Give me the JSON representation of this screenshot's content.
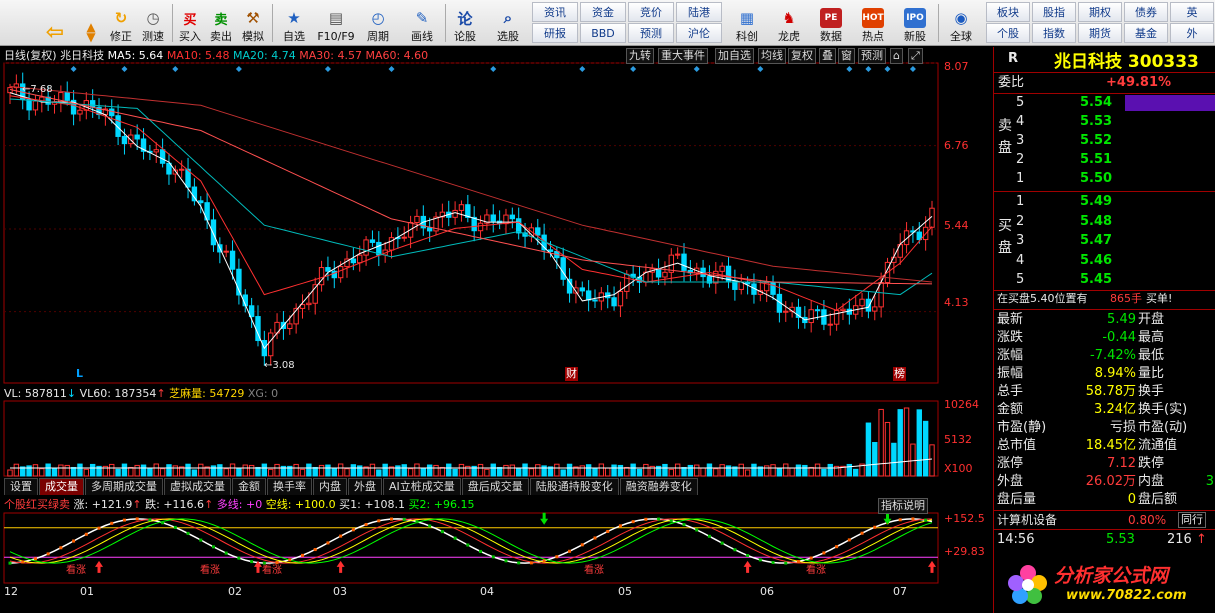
{
  "toolbar": {
    "buttons": [
      {
        "label": "修正"
      },
      {
        "label": "测速"
      },
      {
        "label": "买入",
        "glyph": "买"
      },
      {
        "label": "卖出",
        "glyph": "卖"
      },
      {
        "label": "模拟"
      },
      {
        "label": "自选"
      },
      {
        "label": "F10/F9"
      },
      {
        "label": "周期"
      },
      {
        "label": "画线"
      },
      {
        "label": "论股",
        "glyph": "论"
      },
      {
        "label": "选股"
      },
      {
        "label": "科创"
      },
      {
        "label": "龙虎"
      },
      {
        "label": "数据"
      },
      {
        "label": "热点"
      },
      {
        "label": "新股"
      },
      {
        "label": "全球"
      }
    ],
    "grid_left": [
      "资讯",
      "资金",
      "竞价",
      "陆港",
      "研报",
      "BBD",
      "预测",
      "沪伦"
    ],
    "grid_right": [
      "板块",
      "股指",
      "期权",
      "债券",
      "个股",
      "指数",
      "期货",
      "基金"
    ],
    "grid_right_cut": [
      "英",
      "外"
    ]
  },
  "chart_header": {
    "period": "日线(复权)",
    "stock_name": "兆日科技",
    "ma": [
      {
        "label": "MA5: 5.64",
        "color": "#ffffff"
      },
      {
        "label": "MA10: 5.48",
        "color": "#ff3030"
      },
      {
        "label": "MA20: 4.74",
        "color": "#00cccc"
      },
      {
        "label": "MA30: 4.57",
        "color": "#ff4040"
      },
      {
        "label": "MA60: 4.60",
        "color": "#ff4040"
      }
    ],
    "tags": [
      "九转",
      "重大事件",
      "加自选",
      "均线",
      "复权",
      "叠",
      "窗",
      "预测"
    ]
  },
  "price_axis": [
    "8.07",
    "6.76",
    "5.44",
    "4.13"
  ],
  "markers": {
    "high_label": "7.68",
    "low_label": "3.08",
    "events": [
      "L",
      "财",
      "榜"
    ]
  },
  "volume_header": {
    "vl": "VL: 587811",
    "vl60": "VL60: 187354",
    "zhima": "芝麻量: 54729",
    "xg": "XG: 0"
  },
  "volume_axis": [
    "10264",
    "5132",
    "X100"
  ],
  "tabs": [
    {
      "label": "设置",
      "active": false
    },
    {
      "label": "成交量",
      "active": true
    },
    {
      "label": "多周期成交量",
      "active": false
    },
    {
      "label": "虚拟成交量",
      "active": false
    },
    {
      "label": "金额",
      "active": false
    },
    {
      "label": "换手率",
      "active": false
    },
    {
      "label": "内盘",
      "active": false
    },
    {
      "label": "外盘",
      "active": false
    },
    {
      "label": "AI立桩成交量",
      "active": false
    },
    {
      "label": "盘后成交量",
      "active": false
    },
    {
      "label": "陆股通持股变化",
      "active": false
    },
    {
      "label": "融资融券变化",
      "active": false
    }
  ],
  "indicator_button": "指标说明",
  "indicator_header": {
    "name": "个股红买绿卖",
    "zhang": "涨: +121.9",
    "die": "跌: +116.6",
    "duoxian": "多线: +0",
    "kongxian": "空线: +100.0",
    "mai1": "买1: +108.1",
    "mai2": "买2: +96.15"
  },
  "indicator_axis": [
    "+152.5",
    "+29.83"
  ],
  "indicator_marks": [
    "看涨",
    "看涨",
    "看涨",
    "看涨",
    "看涨"
  ],
  "x_axis": [
    "12",
    "01",
    "02",
    "03",
    "04",
    "05",
    "06",
    "07"
  ],
  "chart_data": {
    "type": "line",
    "title": "",
    "series": [
      {
        "name": "MA5",
        "x": [
          0,
          5,
          10,
          15,
          20,
          25,
          30,
          35,
          40,
          45,
          50,
          55,
          60,
          65,
          70,
          75,
          80,
          85,
          90,
          95,
          100,
          105,
          110,
          115,
          120,
          125,
          130,
          135,
          140,
          145
        ],
        "values": [
          7.6,
          7.45,
          7.45,
          7.25,
          6.75,
          6.5,
          5.8,
          4.7,
          3.55,
          4.15,
          4.75,
          5.05,
          5.25,
          5.55,
          5.7,
          5.55,
          5.55,
          5.05,
          4.3,
          4.4,
          4.75,
          4.9,
          4.7,
          4.6,
          4.35,
          4.0,
          4.1,
          4.2,
          5.2,
          5.64
        ]
      },
      {
        "name": "MA10",
        "x": [
          0,
          10,
          20,
          30,
          40,
          50,
          60,
          70,
          80,
          90,
          100,
          110,
          120,
          130,
          140,
          145
        ],
        "values": [
          7.55,
          7.4,
          7.05,
          6.2,
          4.4,
          4.7,
          5.1,
          5.45,
          5.55,
          4.8,
          4.6,
          4.75,
          4.55,
          4.15,
          4.9,
          5.48
        ]
      },
      {
        "name": "MA20",
        "x": [
          0,
          20,
          40,
          60,
          80,
          100,
          120,
          140,
          145
        ],
        "values": [
          7.5,
          7.35,
          5.5,
          5.0,
          5.4,
          4.6,
          4.6,
          4.4,
          4.74
        ]
      },
      {
        "name": "MA30",
        "x": [
          0,
          30,
          60,
          90,
          120,
          145
        ],
        "values": [
          7.65,
          7.0,
          5.6,
          4.95,
          4.6,
          4.57
        ]
      },
      {
        "name": "MA60",
        "x": [
          0,
          30,
          60,
          90,
          120,
          145
        ],
        "values": [
          7.7,
          7.4,
          6.45,
          5.5,
          4.85,
          4.6
        ]
      }
    ],
    "ylim": [
      3.0,
      8.07
    ],
    "high": 7.68,
    "low": 3.08
  },
  "quote": {
    "code_prefix": "R",
    "title": "兆日科技 300333",
    "weibi_label": "委比",
    "weibi_value": "+49.81%",
    "sell_label": [
      "卖",
      "盘"
    ],
    "buy_label": [
      "买",
      "盘"
    ],
    "sell": [
      {
        "level": "5",
        "price": "5.54"
      },
      {
        "level": "4",
        "price": "5.53"
      },
      {
        "level": "3",
        "price": "5.52"
      },
      {
        "level": "2",
        "price": "5.51"
      },
      {
        "level": "1",
        "price": "5.50"
      }
    ],
    "buy": [
      {
        "level": "1",
        "price": "5.49"
      },
      {
        "level": "2",
        "price": "5.48"
      },
      {
        "level": "3",
        "price": "5.47"
      },
      {
        "level": "4",
        "price": "5.46"
      },
      {
        "level": "5",
        "price": "5.45"
      }
    ],
    "sell5_fill": 1.0,
    "notice": "在买盘5.40位置有",
    "notice_qty": "865手",
    "notice_action": "买单!",
    "stats": [
      {
        "l1": "最新",
        "v1": "5.49",
        "c1": "green",
        "l2": "开盘",
        "v2": "",
        "c2": "green"
      },
      {
        "l1": "涨跌",
        "v1": "-0.44",
        "c1": "green",
        "l2": "最高",
        "v2": "",
        "c2": "green"
      },
      {
        "l1": "涨幅",
        "v1": "-7.42%",
        "c1": "green",
        "l2": "最低",
        "v2": "",
        "c2": "green"
      },
      {
        "l1": "振幅",
        "v1": "8.94%",
        "c1": "yellow",
        "l2": "量比",
        "v2": "",
        "c2": "yellow"
      },
      {
        "l1": "总手",
        "v1": "58.78万",
        "c1": "yellow",
        "l2": "换手",
        "v2": "",
        "c2": "yellow"
      },
      {
        "l1": "金额",
        "v1": "3.24亿",
        "c1": "yellow",
        "l2": "换手(实)",
        "v2": "",
        "c2": "yellow"
      },
      {
        "l1": "市盈(静)",
        "v1": "亏损",
        "c1": "white",
        "l2": "市盈(动)",
        "v2": "",
        "c2": "white"
      },
      {
        "l1": "总市值",
        "v1": "18.45亿",
        "c1": "yellow",
        "l2": "流通值",
        "v2": "",
        "c2": "yellow"
      },
      {
        "l1": "涨停",
        "v1": "7.12",
        "c1": "red",
        "l2": "跌停",
        "v2": "",
        "c2": "green"
      },
      {
        "l1": "外盘",
        "v1": "26.02万",
        "c1": "red",
        "l2": "内盘",
        "v2": "3",
        "c2": "green"
      },
      {
        "l1": "盘后量",
        "v1": "0",
        "c1": "yellow",
        "l2": "盘后额",
        "v2": "",
        "c2": "yellow"
      }
    ],
    "sector": "计算机设备",
    "sector_change": "0.80%",
    "sector_btn": "同行",
    "tick_time": "14:56",
    "tick_price": "5.53",
    "tick_vol": "216",
    "tick_arrow": "↑",
    "logo_text": "分析家公式网",
    "logo_url": "www.70822.com"
  }
}
